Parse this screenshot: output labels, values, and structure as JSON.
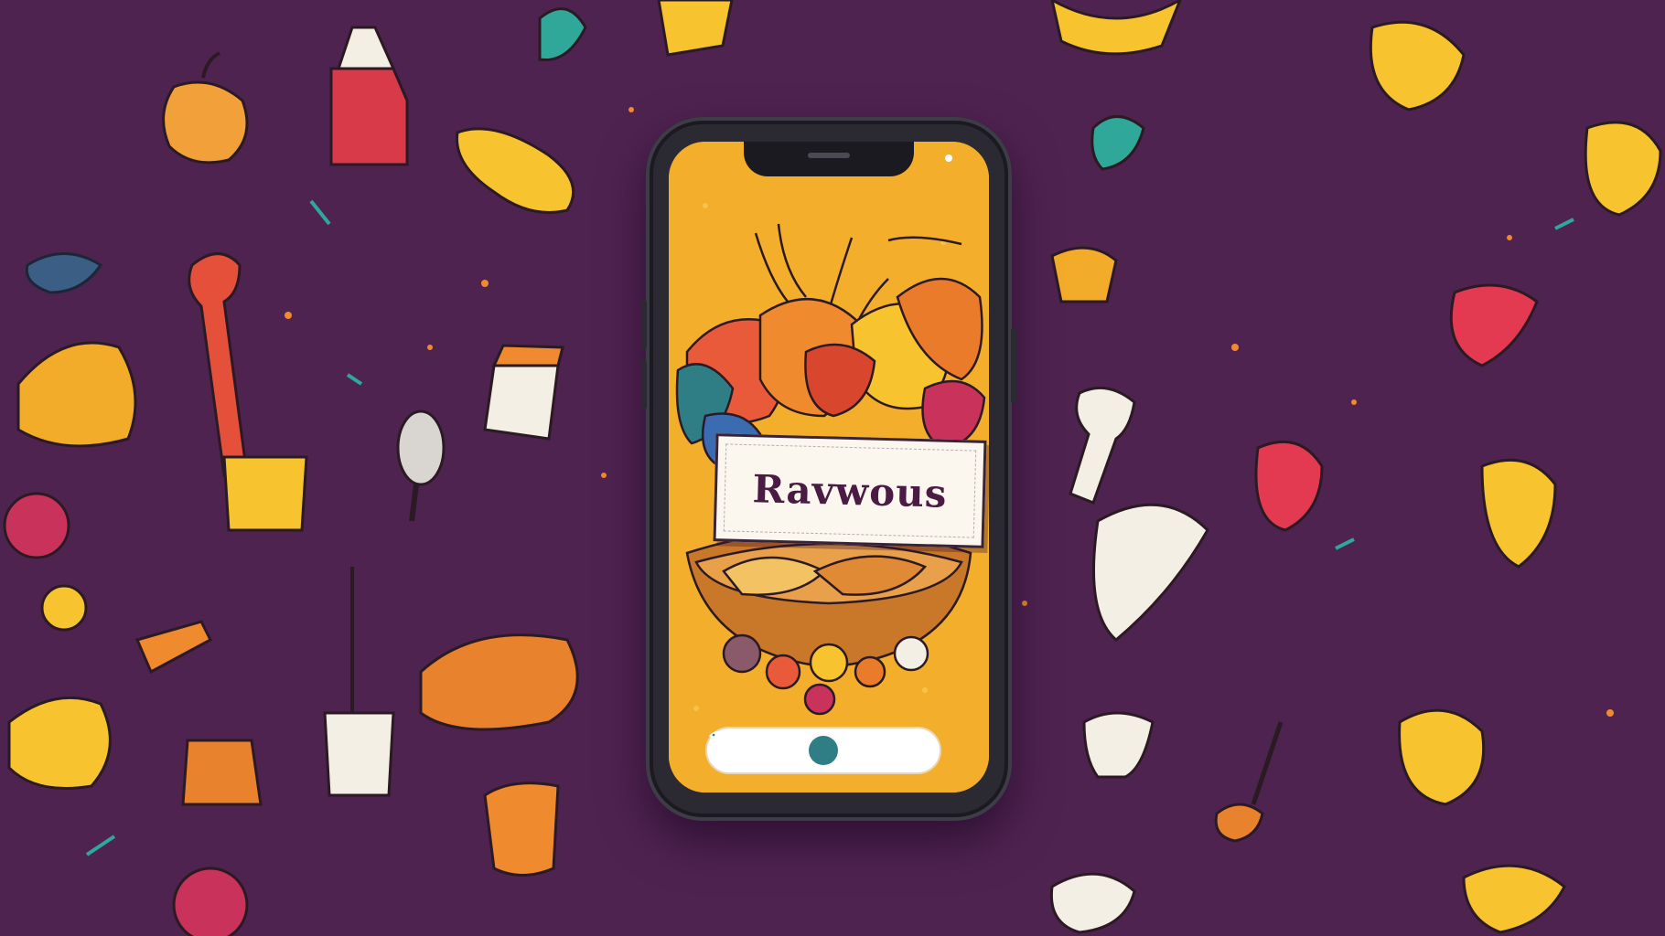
{
  "app": {
    "title": "Ravwous"
  },
  "action_bar": {
    "icon": "fish-icon"
  },
  "colors": {
    "background": "#4f2350",
    "screen": "#f3ae2c",
    "phone_frame": "#2b2a33",
    "title_text": "#4a1c44",
    "action_icon": "#2f7e86"
  }
}
